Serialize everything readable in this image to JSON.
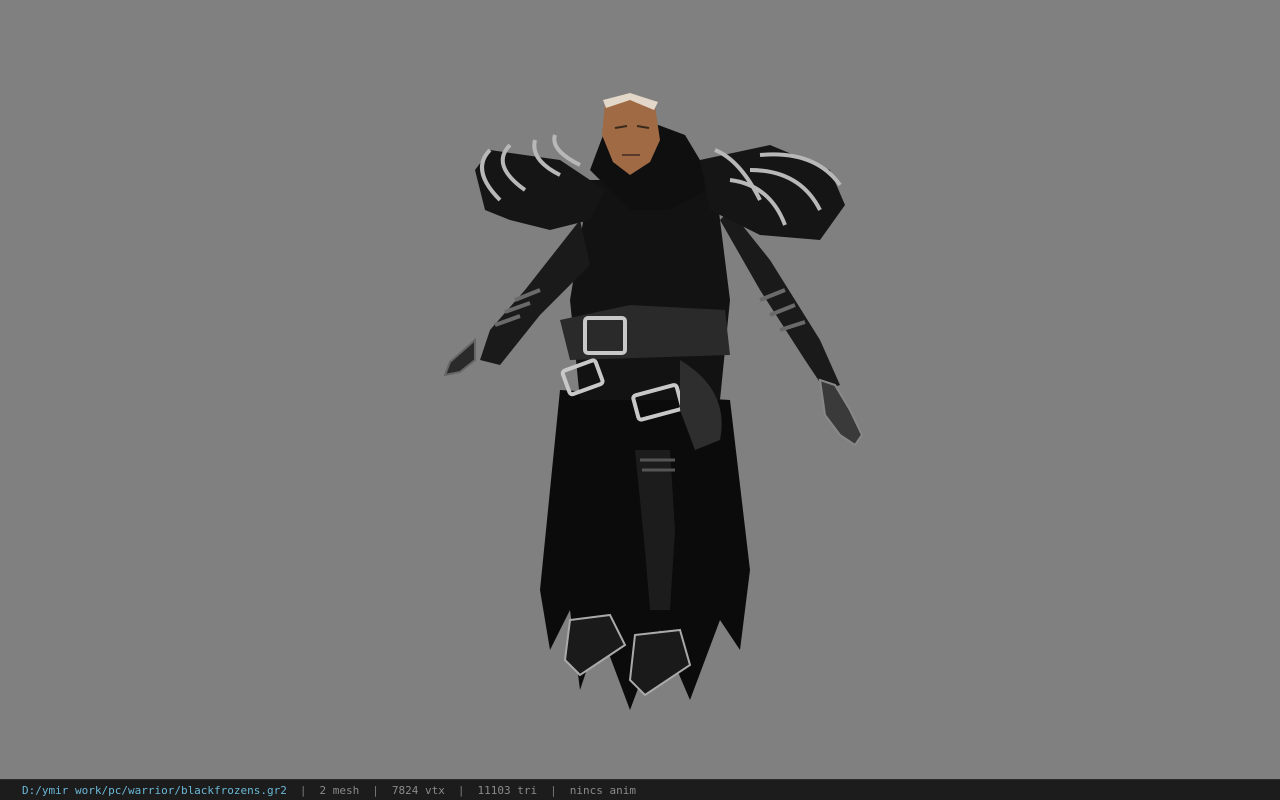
{
  "viewport": {
    "background_color": "#808080",
    "model_subject": "dark-armored-warrior-model"
  },
  "status_bar": {
    "file_path": "D:/ymir work/pc/warrior/blackfrozens.gr2",
    "separator": "|",
    "mesh_count": "2 mesh",
    "vertex_count": "7824 vtx",
    "triangle_count": "11103 tri",
    "animation_status": "nincs anim",
    "path_color": "#69b7d6",
    "text_color": "#8a8a8a",
    "background_color": "#1c1c1c"
  }
}
